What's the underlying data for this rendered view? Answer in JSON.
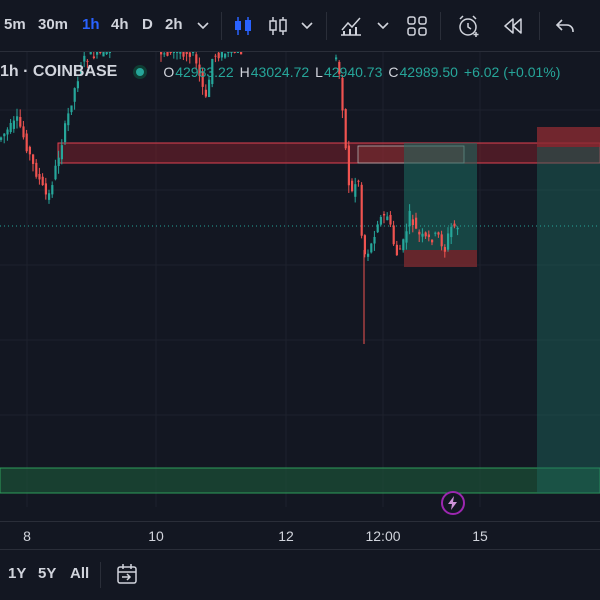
{
  "toolbar": {
    "timeframes": [
      {
        "label": "5m",
        "active": false
      },
      {
        "label": "30m",
        "active": false
      },
      {
        "label": "1h",
        "active": true
      },
      {
        "label": "4h",
        "active": false
      },
      {
        "label": "D",
        "active": false
      },
      {
        "label": "2h",
        "active": false
      }
    ],
    "icons": [
      "chevron-down-icon",
      "candles-icon",
      "candles-outline-icon",
      "chevron-down-icon",
      "indicators-icon",
      "chevron-down-icon",
      "layout-grid-icon",
      "alert-clock-icon",
      "replay-icon",
      "undo-icon"
    ]
  },
  "legend": {
    "symbol": "1h · COINBASE",
    "open_label": "O",
    "open": "42983.22",
    "high_label": "H",
    "high": "43024.72",
    "low_label": "L",
    "low": "42940.73",
    "close_label": "C",
    "close": "42989.50",
    "change": "+6.02 (+0.01%)"
  },
  "time_axis": {
    "labels": [
      "8",
      "10",
      "12",
      "12:00",
      "15"
    ]
  },
  "bottom_bar": {
    "ranges": [
      "1Y",
      "5Y",
      "All"
    ]
  },
  "colors": {
    "background": "#131722",
    "up": "#26a69a",
    "down": "#ef5350",
    "accent": "#2962ff",
    "grid": "#1e222d"
  }
}
